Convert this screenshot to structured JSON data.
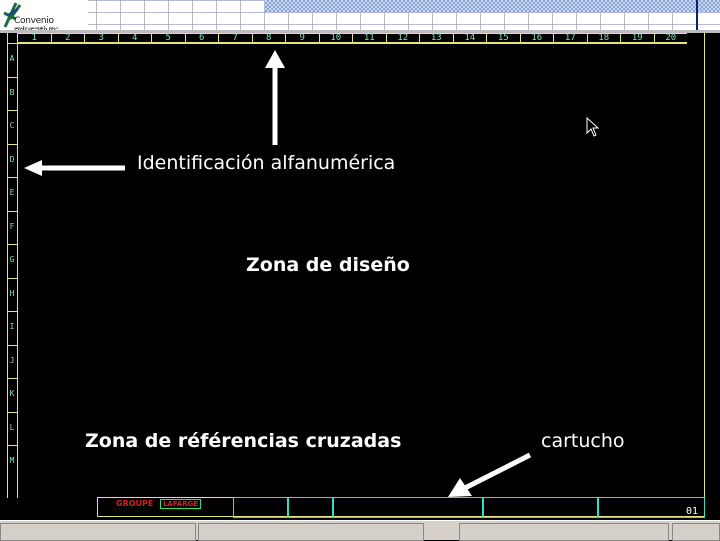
{
  "logo": {
    "name": "Convenio educativo",
    "subtitle": "SEMA · EL PROYECTO · MECAL"
  },
  "grid": {
    "columns": [
      "1",
      "2",
      "3",
      "4",
      "5",
      "6",
      "7",
      "8",
      "9",
      "10",
      "11",
      "12",
      "13",
      "14",
      "15",
      "16",
      "17",
      "18",
      "19",
      "20"
    ],
    "rows": [
      "A",
      "B",
      "C",
      "D",
      "E",
      "F",
      "G",
      "H",
      "I",
      "J",
      "K",
      "L",
      "M"
    ]
  },
  "annotations": {
    "alnum": "Identificación alfanumérica",
    "design": "Zona de diseño",
    "crossref": "Zona de référencias cruzadas",
    "titleblock": "cartucho"
  },
  "titleblock": {
    "company": "GROUPE",
    "logo_text": "LAFARGE",
    "sheet": "01"
  },
  "colors": {
    "border": "#e8e27a",
    "labels": "#7de0b8",
    "titleblock": "#2ee0c8",
    "company": "#d02020"
  }
}
